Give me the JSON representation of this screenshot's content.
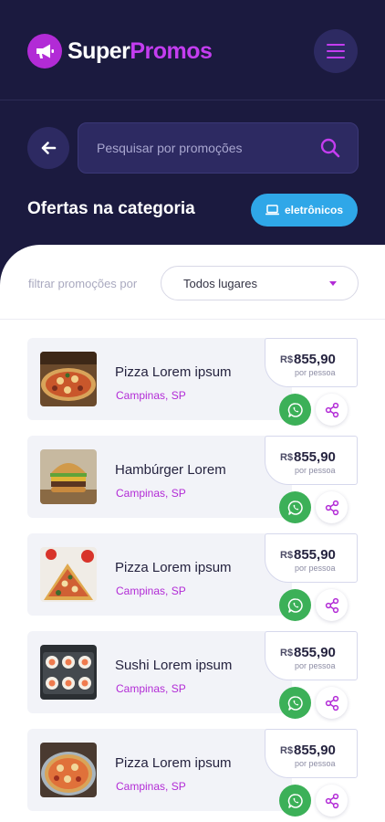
{
  "app": {
    "name_part1": "Super",
    "name_part2": "Promos"
  },
  "search": {
    "placeholder": "Pesquisar por promoções"
  },
  "section": {
    "title": "Ofertas na categoria",
    "category": "eletrônicos"
  },
  "filter": {
    "label": "filtrar promoções por",
    "selected": "Todos lugares"
  },
  "colors": {
    "brand_purple": "#b22bd6",
    "header_bg": "#1b1a3f",
    "category_blue": "#2fa7e8",
    "whatsapp_green": "#3cb058"
  },
  "offers": [
    {
      "title": "Pizza Lorem ipsum",
      "location": "Campinas, SP",
      "currency": "R$",
      "price": "855,90",
      "unit": "por pessoa"
    },
    {
      "title": "Hambúrger Lorem",
      "location": "Campinas, SP",
      "currency": "R$",
      "price": "855,90",
      "unit": "por pessoa"
    },
    {
      "title": "Pizza Lorem ipsum",
      "location": "Campinas, SP",
      "currency": "R$",
      "price": "855,90",
      "unit": "por pessoa"
    },
    {
      "title": "Sushi Lorem ipsum",
      "location": "Campinas, SP",
      "currency": "R$",
      "price": "855,90",
      "unit": "por pessoa"
    },
    {
      "title": "Pizza Lorem ipsum",
      "location": "Campinas, SP",
      "currency": "R$",
      "price": "855,90",
      "unit": "por pessoa"
    }
  ]
}
